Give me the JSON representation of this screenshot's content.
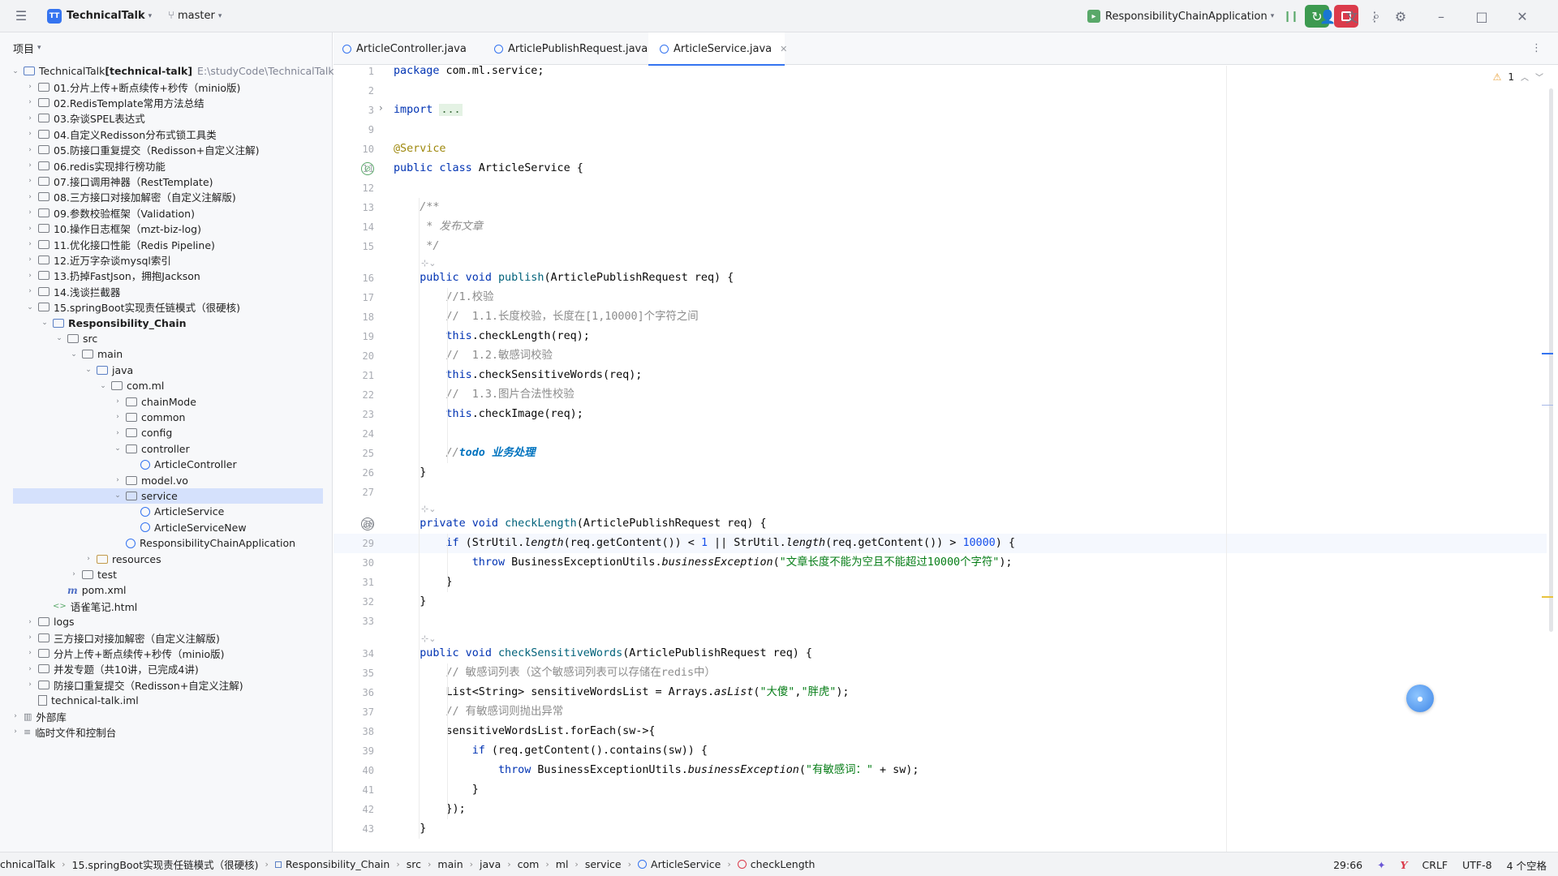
{
  "toolbar": {
    "project_badge": "TT",
    "project_name": "TechnicalTalk",
    "branch": "master",
    "run_config": "ResponsibilityChainApplication"
  },
  "panel": {
    "title": "项目"
  },
  "tree": [
    {
      "indent": 0,
      "arrow": "open",
      "icon": "module",
      "label": "TechnicalTalk",
      "bold": "[technical-talk]",
      "path": "E:\\studyCode\\TechnicalTalk"
    },
    {
      "indent": 1,
      "arrow": "closed",
      "icon": "folder",
      "label": "01.分片上传+断点续传+秒传（minio版)"
    },
    {
      "indent": 1,
      "arrow": "closed",
      "icon": "folder",
      "label": "02.RedisTemplate常用方法总结"
    },
    {
      "indent": 1,
      "arrow": "closed",
      "icon": "folder",
      "label": "03.杂谈SPEL表达式"
    },
    {
      "indent": 1,
      "arrow": "closed",
      "icon": "folder",
      "label": "04.自定义Redisson分布式锁工具类"
    },
    {
      "indent": 1,
      "arrow": "closed",
      "icon": "folder",
      "label": "05.防接口重复提交（Redisson+自定义注解)"
    },
    {
      "indent": 1,
      "arrow": "closed",
      "icon": "folder",
      "label": "06.redis实现排行榜功能"
    },
    {
      "indent": 1,
      "arrow": "closed",
      "icon": "folder",
      "label": "07.接口调用神器（RestTemplate)"
    },
    {
      "indent": 1,
      "arrow": "closed",
      "icon": "folder",
      "label": "08.三方接口对接加解密（自定义注解版)"
    },
    {
      "indent": 1,
      "arrow": "closed",
      "icon": "folder",
      "label": "09.参数校验框架（Validation)"
    },
    {
      "indent": 1,
      "arrow": "closed",
      "icon": "folder",
      "label": "10.操作日志框架（mzt-biz-log)"
    },
    {
      "indent": 1,
      "arrow": "closed",
      "icon": "folder",
      "label": "11.优化接口性能（Redis Pipeline)"
    },
    {
      "indent": 1,
      "arrow": "closed",
      "icon": "folder",
      "label": "12.近万字杂谈mysql索引"
    },
    {
      "indent": 1,
      "arrow": "closed",
      "icon": "folder",
      "label": "13.扔掉FastJson，拥抱Jackson"
    },
    {
      "indent": 1,
      "arrow": "closed",
      "icon": "folder",
      "label": "14.浅谈拦截器"
    },
    {
      "indent": 1,
      "arrow": "open",
      "icon": "folder",
      "label": "15.springBoot实现责任链模式（很硬核)"
    },
    {
      "indent": 2,
      "arrow": "open",
      "icon": "module",
      "label": "",
      "bold": "Responsibility_Chain"
    },
    {
      "indent": 3,
      "arrow": "open",
      "icon": "folder",
      "label": "src"
    },
    {
      "indent": 4,
      "arrow": "open",
      "icon": "folder",
      "label": "main"
    },
    {
      "indent": 5,
      "arrow": "open",
      "icon": "src",
      "label": "java"
    },
    {
      "indent": 6,
      "arrow": "open",
      "icon": "folder",
      "label": "com.ml"
    },
    {
      "indent": 7,
      "arrow": "closed",
      "icon": "folder",
      "label": "chainMode"
    },
    {
      "indent": 7,
      "arrow": "closed",
      "icon": "folder",
      "label": "common"
    },
    {
      "indent": 7,
      "arrow": "closed",
      "icon": "folder",
      "label": "config"
    },
    {
      "indent": 7,
      "arrow": "open",
      "icon": "folder",
      "label": "controller"
    },
    {
      "indent": 8,
      "arrow": "none",
      "icon": "class",
      "label": "ArticleController"
    },
    {
      "indent": 7,
      "arrow": "closed",
      "icon": "folder",
      "label": "model.vo"
    },
    {
      "indent": 7,
      "arrow": "open",
      "icon": "folder",
      "label": "service",
      "selected": "yes"
    },
    {
      "indent": 8,
      "arrow": "none",
      "icon": "class",
      "label": "ArticleService"
    },
    {
      "indent": 8,
      "arrow": "none",
      "icon": "class",
      "label": "ArticleServiceNew"
    },
    {
      "indent": 7,
      "arrow": "none",
      "icon": "class",
      "label": "ResponsibilityChainApplication"
    },
    {
      "indent": 5,
      "arrow": "closed",
      "icon": "res",
      "label": "resources"
    },
    {
      "indent": 4,
      "arrow": "closed",
      "icon": "folder",
      "label": "test"
    },
    {
      "indent": 3,
      "arrow": "none",
      "icon": "maven",
      "label": "pom.xml"
    },
    {
      "indent": 2,
      "arrow": "none",
      "icon": "html",
      "label": "语雀笔记.html"
    },
    {
      "indent": 1,
      "arrow": "closed",
      "icon": "folder",
      "label": "logs"
    },
    {
      "indent": 1,
      "arrow": "closed",
      "icon": "folder",
      "label": "三方接口对接加解密（自定义注解版)"
    },
    {
      "indent": 1,
      "arrow": "closed",
      "icon": "folder",
      "label": "分片上传+断点续传+秒传（minio版)"
    },
    {
      "indent": 1,
      "arrow": "closed",
      "icon": "folder",
      "label": "并发专题（共10讲，已完成4讲)"
    },
    {
      "indent": 1,
      "arrow": "closed",
      "icon": "folder",
      "label": "防接口重复提交（Redisson+自定义注解)"
    },
    {
      "indent": 1,
      "arrow": "none",
      "icon": "iml",
      "label": "technical-talk.iml"
    },
    {
      "indent": 0,
      "arrow": "closed",
      "icon": "lib",
      "label": "外部库"
    },
    {
      "indent": 0,
      "arrow": "closed",
      "icon": "scratch",
      "label": "临时文件和控制台"
    }
  ],
  "tabs": [
    {
      "label": "ArticleController.java",
      "active": "no"
    },
    {
      "label": "ArticlePublishRequest.java",
      "active": "no"
    },
    {
      "label": "ArticleService.java",
      "active": "yes"
    }
  ],
  "editor": {
    "warning_count": "1",
    "lines": [
      {
        "n": "1",
        "html": "<span class=\"kw\">package</span> com.ml.service;"
      },
      {
        "n": "2",
        "html": ""
      },
      {
        "n": "3",
        "html": "<span class=\"kw\">import</span> <span class=\"imp\">...</span>"
      },
      {
        "n": "9",
        "html": ""
      },
      {
        "n": "10",
        "html": "<span class=\"ann\">@Service</span>"
      },
      {
        "n": "11",
        "html": "<span class=\"kw\">public class</span> ArticleService {"
      },
      {
        "n": "12",
        "html": ""
      },
      {
        "n": "13",
        "html": "    <span class=\"cmi\">/**</span>"
      },
      {
        "n": "14",
        "html": "    <span class=\"cmi\"> * 发布文章</span>"
      },
      {
        "n": "15",
        "html": "    <span class=\"cmi\"> */</span>"
      },
      {
        "n": "16",
        "html": "    <span class=\"kw\">public void</span> <span class=\"fn\">publish</span>(ArticlePublishRequest req) {"
      },
      {
        "n": "17",
        "html": "        <span class=\"cm\">//1.校验</span>"
      },
      {
        "n": "18",
        "html": "        <span class=\"cm\">//  1.1.长度校验，长度在[1,10000]个字符之间</span>"
      },
      {
        "n": "19",
        "html": "        <span class=\"kw\">this</span>.checkLength(req);"
      },
      {
        "n": "20",
        "html": "        <span class=\"cm\">//  1.2.敏感词校验</span>"
      },
      {
        "n": "21",
        "html": "        <span class=\"kw\">this</span>.checkSensitiveWords(req);"
      },
      {
        "n": "22",
        "html": "        <span class=\"cm\">//  1.3.图片合法性校验</span>"
      },
      {
        "n": "23",
        "html": "        <span class=\"kw\">this</span>.checkImage(req);"
      },
      {
        "n": "24",
        "html": ""
      },
      {
        "n": "25",
        "html": "        <span class=\"cmi\">//</span><span class=\"todo\">todo 业务处理</span>"
      },
      {
        "n": "26",
        "html": "    }"
      },
      {
        "n": "27",
        "html": ""
      },
      {
        "n": "28",
        "html": "    <span class=\"kw\">private void</span> <span class=\"fn\">checkLength</span>(ArticlePublishRequest req) {"
      },
      {
        "n": "29",
        "html": "        <span class=\"kw\">if</span> (StrUtil.<i>length</i>(req.getContent()) &lt; <span class=\"num\">1</span> || StrUtil.<i>length</i>(req.getContent()) &gt; <span class=\"num\">10000</span>) {"
      },
      {
        "n": "30",
        "html": "            <span class=\"kw\">throw</span> BusinessExceptionUtils.<i>businessException</i>(<span class=\"str\">\"文章长度不能为空且不能超过10000个字符\"</span>);"
      },
      {
        "n": "31",
        "html": "        }"
      },
      {
        "n": "32",
        "html": "    }"
      },
      {
        "n": "33",
        "html": ""
      },
      {
        "n": "34",
        "html": "    <span class=\"kw\">public void</span> <span class=\"fn\">checkSensitiveWords</span>(ArticlePublishRequest req) {"
      },
      {
        "n": "35",
        "html": "        <span class=\"cm\">// 敏感词列表（这个敏感词列表可以存储在redis中）</span>"
      },
      {
        "n": "36",
        "html": "        List&lt;String&gt; sensitiveWordsList = Arrays.<i>asList</i>(<span class=\"str\">\"大傻\"</span>,<span class=\"str\">\"胖虎\"</span>);"
      },
      {
        "n": "37",
        "html": "        <span class=\"cm\">// 有敏感词则抛出异常</span>"
      },
      {
        "n": "38",
        "html": "        sensitiveWordsList.forEach(sw-&gt;{"
      },
      {
        "n": "39",
        "html": "            <span class=\"kw\">if</span> (req.getContent().contains(sw)) {"
      },
      {
        "n": "40",
        "html": "                <span class=\"kw\">throw</span> BusinessExceptionUtils.<i>businessException</i>(<span class=\"str\">\"有敏感词：\"</span> + sw);"
      },
      {
        "n": "41",
        "html": "            }"
      },
      {
        "n": "42",
        "html": "        });"
      },
      {
        "n": "43",
        "html": "    }"
      }
    ]
  },
  "breadcrumbs": [
    "chnicalTalk",
    "15.springBoot实现责任链模式（很硬核)",
    "Responsibility_Chain",
    "src",
    "main",
    "java",
    "com",
    "ml",
    "service",
    "ArticleService",
    "checkLength"
  ],
  "status": {
    "position": "29:66",
    "line_sep": "CRLF",
    "encoding": "UTF-8",
    "indent": "4 个空格"
  }
}
